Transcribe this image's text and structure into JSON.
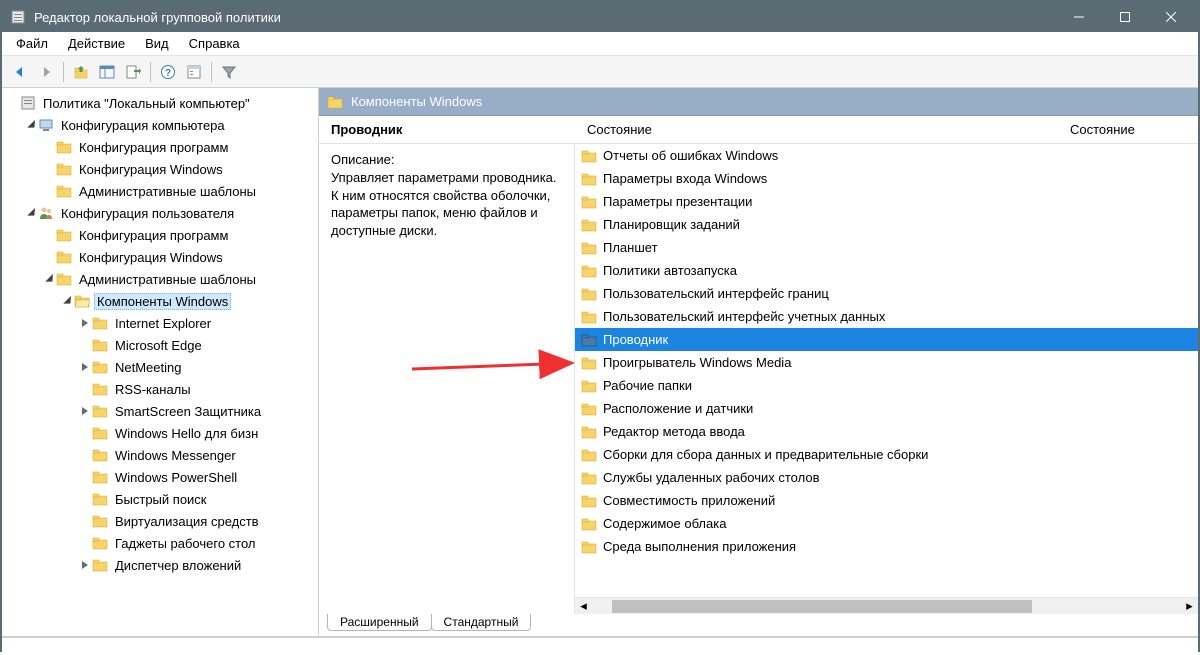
{
  "window": {
    "title": "Редактор локальной групповой политики"
  },
  "menu": {
    "file": "Файл",
    "action": "Действие",
    "view": "Вид",
    "help": "Справка"
  },
  "tree": {
    "root": "Политика \"Локальный компьютер\"",
    "computer_config": "Конфигурация компьютера",
    "cc_software": "Конфигурация программ",
    "cc_windows": "Конфигурация Windows",
    "cc_admin": "Административные шаблоны",
    "user_config": "Конфигурация пользователя",
    "uc_software": "Конфигурация программ",
    "uc_windows": "Конфигурация Windows",
    "uc_admin": "Административные шаблоны",
    "win_components": "Компоненты Windows",
    "ie": "Internet Explorer",
    "edge": "Microsoft Edge",
    "netmeeting": "NetMeeting",
    "rss": "RSS-каналы",
    "smartscreen": "SmartScreen Защитника",
    "hello": "Windows Hello для бизн",
    "messenger": "Windows Messenger",
    "powershell": "Windows PowerShell",
    "search": "Быстрый поиск",
    "virt": "Виртуализация средств",
    "gadgets": "Гаджеты рабочего стол",
    "attach": "Диспетчер вложений"
  },
  "rightHeader": "Компоненты Windows",
  "columns": {
    "state1": "Состояние",
    "state2": "Состояние"
  },
  "description": {
    "title": "Проводник",
    "label": "Описание:",
    "text": "Управляет параметрами проводника. К ним относятся свойства оболочки, параметры папок, меню файлов и доступные диски."
  },
  "listItems": [
    "Отчеты об ошибках Windows",
    "Параметры входа Windows",
    "Параметры презентации",
    "Планировщик заданий",
    "Планшет",
    "Политики автозапуска",
    "Пользовательский интерфейс границ",
    "Пользовательский интерфейс учетных данных",
    "Проводник",
    "Проигрыватель Windows Media",
    "Рабочие папки",
    "Расположение и датчики",
    "Редактор метода ввода",
    "Сборки для сбора данных и предварительные сборки",
    "Службы удаленных рабочих столов",
    "Совместимость приложений",
    "Содержимое облака",
    "Среда выполнения приложения"
  ],
  "selectedIndex": 8,
  "tabs": {
    "extended": "Расширенный",
    "standard": "Стандартный"
  }
}
